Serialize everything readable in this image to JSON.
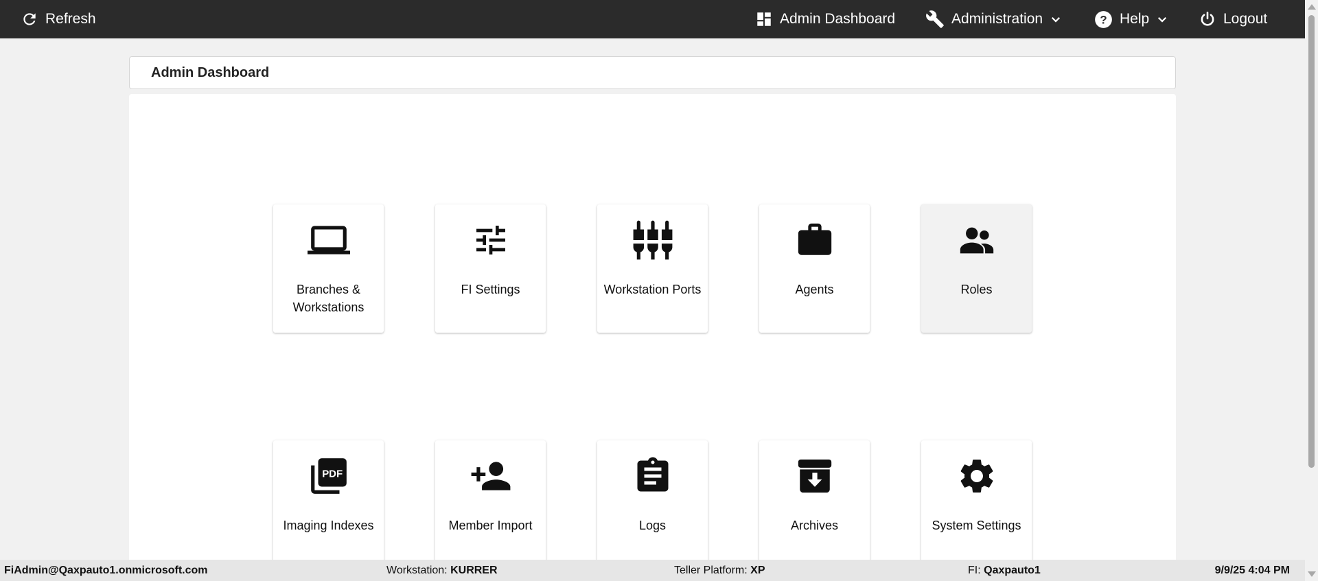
{
  "topbar": {
    "refresh_label": "Refresh",
    "admin_dashboard_label": "Admin Dashboard",
    "administration_label": "Administration",
    "help_label": "Help",
    "logout_label": "Logout"
  },
  "page": {
    "title": "Admin Dashboard"
  },
  "tiles": [
    {
      "label": "Branches & Workstations",
      "icon": "laptop-icon"
    },
    {
      "label": "FI Settings",
      "icon": "tune-icon"
    },
    {
      "label": "Workstation Ports",
      "icon": "settings-input-component-icon"
    },
    {
      "label": "Agents",
      "icon": "briefcase-icon"
    },
    {
      "label": "Roles",
      "icon": "people-icon"
    },
    {
      "label": "Imaging Indexes",
      "icon": "picture-as-pdf-icon"
    },
    {
      "label": "Member Import",
      "icon": "person-add-icon"
    },
    {
      "label": "Logs",
      "icon": "assignment-icon"
    },
    {
      "label": "Archives",
      "icon": "archive-icon"
    },
    {
      "label": "System Settings",
      "icon": "gear-icon"
    }
  ],
  "statusbar": {
    "user": "FiAdmin@Qaxpauto1.onmicrosoft.com",
    "workstation_label": "Workstation:",
    "workstation_value": "KURRER",
    "teller_platform_label": "Teller Platform:",
    "teller_platform_value": "XP",
    "fi_label": "FI:",
    "fi_value": "Qaxpauto1",
    "datetime": "9/9/25 4:04 PM"
  },
  "colors": {
    "topbar_bg": "#2b2b2b",
    "page_bg": "#f1f1f1",
    "tile_hover_bg": "#f2f2f2"
  }
}
